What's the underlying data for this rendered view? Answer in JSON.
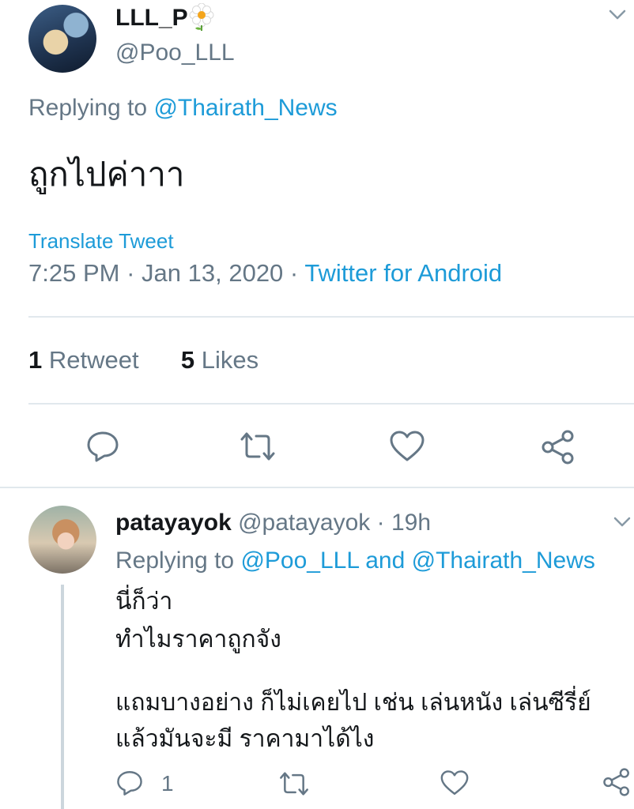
{
  "tweet": {
    "display_name": "LLL_P",
    "name_emoji": "🌼",
    "handle": "@Poo_LLL",
    "replying_prefix": "Replying to",
    "replying_to": "@Thairath_News",
    "text": "ถูกไปค่าาา",
    "translate_label": "Translate Tweet",
    "time": "7:25 PM",
    "date": "Jan 13, 2020",
    "dot": "·",
    "source": "Twitter for Android",
    "retweet_count": "1",
    "retweet_label": "Retweet",
    "like_count": "5",
    "like_label": "Likes"
  },
  "reply": {
    "display_name": "patayayok",
    "handle": "@patayayok",
    "dot": "·",
    "age": "19h",
    "replying_prefix": "Replying to",
    "replying_to_1": "@Poo_LLL",
    "and_text": "and",
    "replying_to_2": "@Thairath_News",
    "lines": [
      "นี่ก็ว่า",
      "ทำไมราคาถูกจัง",
      "แถมบางอย่าง ก็ไม่เคยไป เช่น เล่นหนัง เล่นซีรี่ย์",
      "แล้วมันจะมี ราคามาได้ไง"
    ],
    "reply_count": "1"
  },
  "colors": {
    "link": "#1d9bd8",
    "secondary_text": "#657786",
    "primary_text": "#14171a",
    "divider": "#e1e8ed",
    "thread_line": "#ccd6dd"
  },
  "icons": [
    "chevron-down-icon",
    "reply-icon",
    "retweet-icon",
    "like-icon",
    "share-icon"
  ]
}
